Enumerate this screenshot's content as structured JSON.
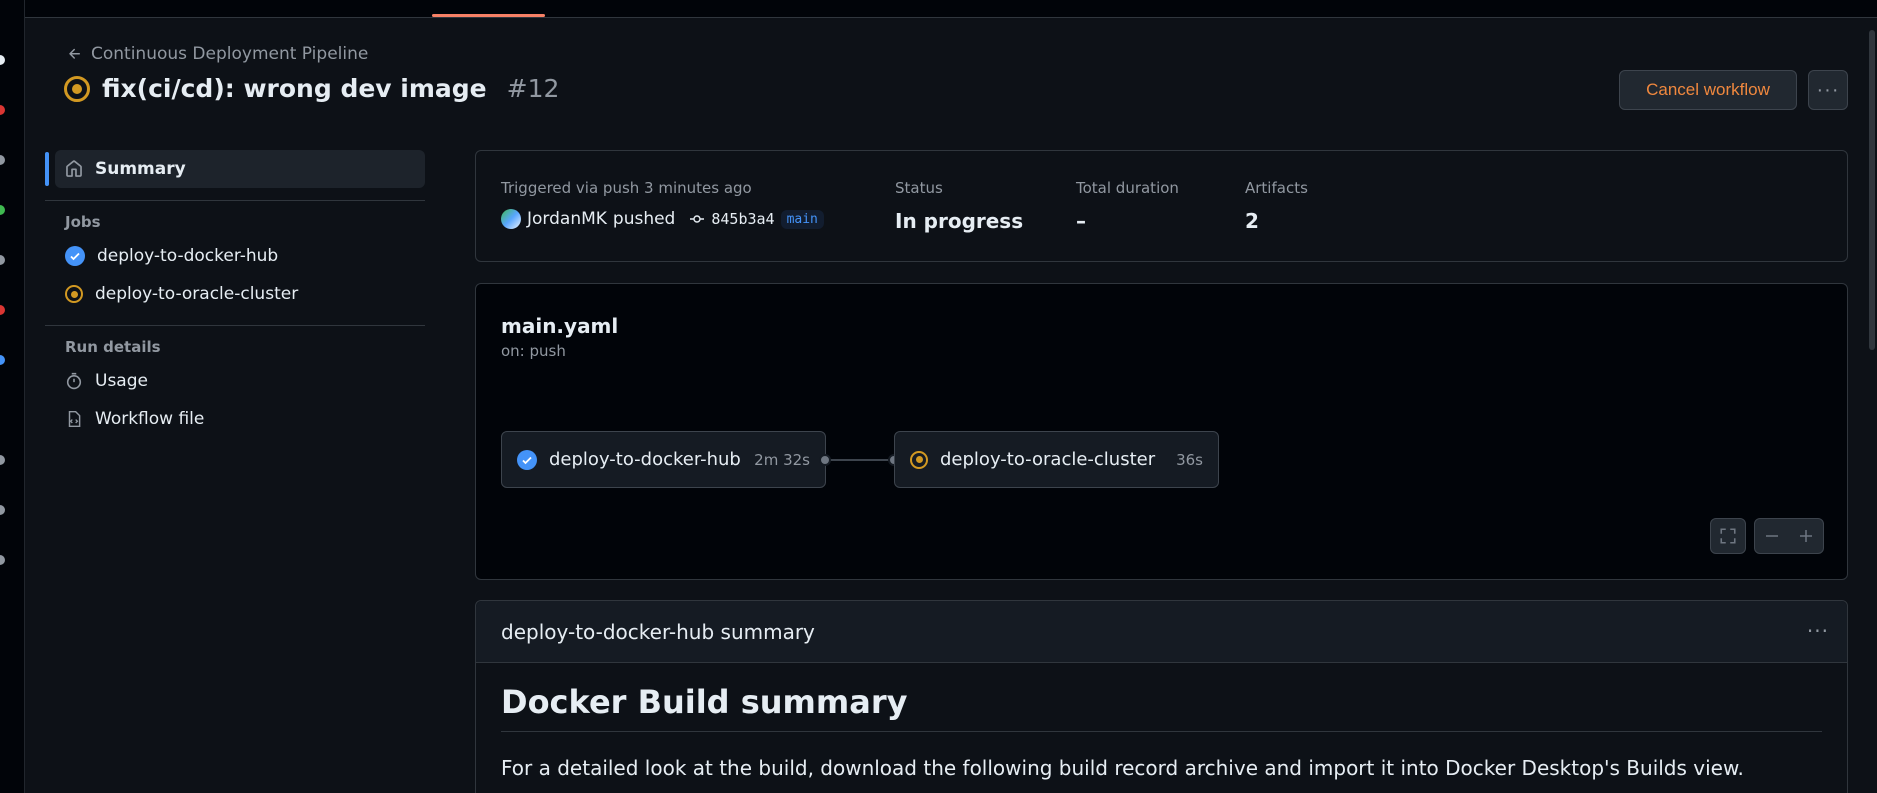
{
  "header": {
    "back_label": "Continuous Deployment Pipeline",
    "run_title": "fix(ci/cd): wrong dev image",
    "run_number": "#12",
    "cancel_label": "Cancel workflow",
    "more_label": "···"
  },
  "sidebar": {
    "summary_label": "Summary",
    "jobs_heading": "Jobs",
    "jobs": [
      {
        "label": "deploy-to-docker-hub",
        "status": "success"
      },
      {
        "label": "deploy-to-oracle-cluster",
        "status": "in_progress"
      }
    ],
    "run_details_heading": "Run details",
    "usage_label": "Usage",
    "workflow_file_label": "Workflow file"
  },
  "trigger": {
    "triggered_label": "Triggered via push 3 minutes ago",
    "user": "JordanMK",
    "action": "pushed",
    "sha": "845b3a4",
    "branch": "main",
    "status_label": "Status",
    "status_value": "In progress",
    "duration_label": "Total duration",
    "duration_value": "–",
    "artifacts_label": "Artifacts",
    "artifacts_value": "2"
  },
  "graph": {
    "file": "main.yaml",
    "on": "on: push",
    "jobs": [
      {
        "label": "deploy-to-docker-hub",
        "duration": "2m 32s",
        "status": "success"
      },
      {
        "label": "deploy-to-oracle-cluster",
        "duration": "36s",
        "status": "in_progress"
      }
    ]
  },
  "summary": {
    "header": "deploy-to-docker-hub summary",
    "heading": "Docker Build summary",
    "paragraph": "For a detailed look at the build, download the following build record archive and import it into Docker Desktop's Builds view."
  },
  "colors": {
    "accent": "#4493f8",
    "in_progress": "#d29922",
    "cancel": "#f0883e"
  }
}
